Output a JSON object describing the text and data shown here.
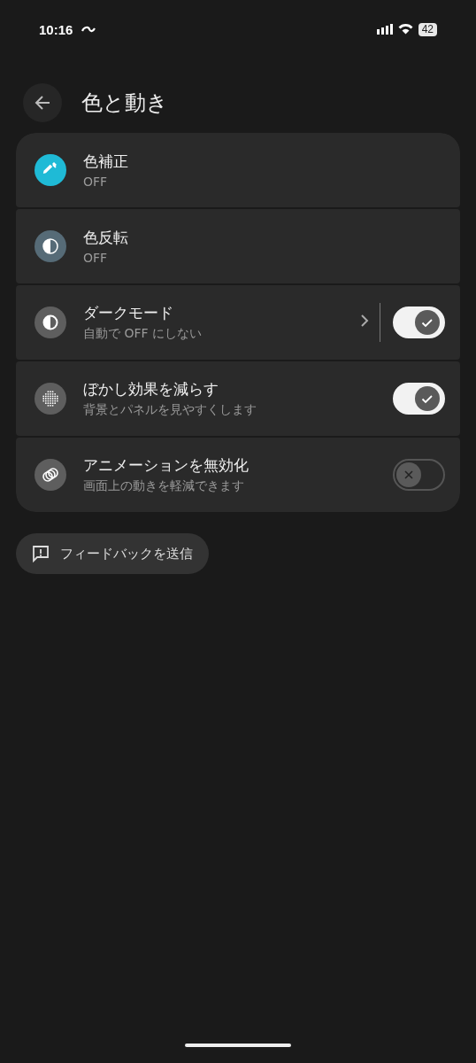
{
  "status_bar": {
    "time": "10:16",
    "battery": "42"
  },
  "header": {
    "title": "色と動き"
  },
  "settings": [
    {
      "kind": "plain",
      "title": "色補正",
      "subtitle": "OFF",
      "color": "#1fbad6"
    },
    {
      "kind": "plain",
      "title": "色反転",
      "subtitle": "OFF",
      "color": "#566b77"
    },
    {
      "kind": "link_toggle",
      "title": "ダークモード",
      "subtitle": "自動で OFF にしない",
      "color": "#5e5e5e",
      "on": true
    },
    {
      "kind": "toggle",
      "title": "ぼかし効果を減らす",
      "subtitle": "背景とパネルを見やすくします",
      "color": "#5e5e5e",
      "on": true
    },
    {
      "kind": "toggle",
      "title": "アニメーションを無効化",
      "subtitle": "画面上の動きを軽減できます",
      "color": "#5e5e5e",
      "on": false
    }
  ],
  "feedback_button": {
    "label": "フィードバックを送信"
  }
}
